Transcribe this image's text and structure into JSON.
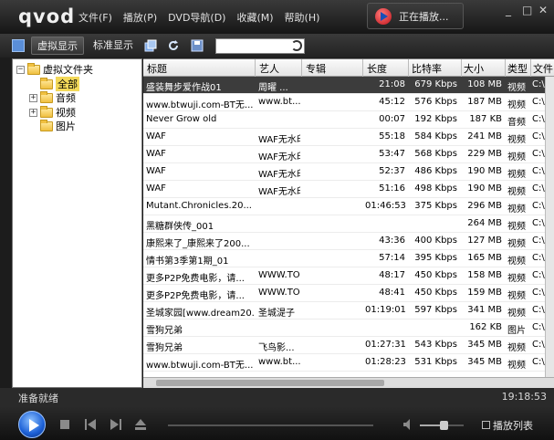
{
  "app": {
    "logo": "qvod",
    "menu": [
      "文件(F)",
      "播放(P)",
      "DVD导航(D)",
      "收藏(M)",
      "帮助(H)"
    ],
    "now_playing": "正在播放...",
    "window_controls": {
      "minimize": "_",
      "maximize": "□",
      "close": "✕"
    }
  },
  "toolbar": {
    "virtual_view": "虚拟显示",
    "standard_view": "标准显示",
    "search": {
      "value": "",
      "placeholder": ""
    }
  },
  "tree": {
    "root": "虚拟文件夹",
    "root_toggle": "−",
    "children": [
      {
        "label": "全部",
        "toggle": "",
        "selected": true
      },
      {
        "label": "音频",
        "toggle": "+",
        "selected": false
      },
      {
        "label": "视频",
        "toggle": "+",
        "selected": false
      },
      {
        "label": "图片",
        "toggle": "",
        "selected": false
      }
    ]
  },
  "list": {
    "columns": [
      "标题",
      "艺人",
      "专辑",
      "长度",
      "比特率",
      "大小",
      "类型",
      "文件"
    ],
    "rows": [
      {
        "title": "盛装舞步爱作战01",
        "artist": "周曜  ...",
        "album": "",
        "length": "21:08",
        "bitrate": "679 Kbps",
        "size": "108 MB",
        "type": "视频",
        "file": "C:\\",
        "selected": true
      },
      {
        "title": "www.btwuji.com-BT无...",
        "artist": "www.bt...",
        "album": "",
        "length": "45:12",
        "bitrate": "576 Kbps",
        "size": "187 MB",
        "type": "视频",
        "file": "C:\\",
        "selected": false
      },
      {
        "title": "Never Grow old",
        "artist": "",
        "album": "",
        "length": "00:07",
        "bitrate": "192 Kbps",
        "size": "187 KB",
        "type": "音频",
        "file": "C:\\",
        "selected": false
      },
      {
        "title": "WAF",
        "artist": "WAF无水印",
        "album": "",
        "length": "55:18",
        "bitrate": "584 Kbps",
        "size": "241 MB",
        "type": "视频",
        "file": "C:\\",
        "selected": false
      },
      {
        "title": "WAF",
        "artist": "WAF无水印",
        "album": "",
        "length": "53:47",
        "bitrate": "568 Kbps",
        "size": "229 MB",
        "type": "视频",
        "file": "C:\\",
        "selected": false
      },
      {
        "title": "WAF",
        "artist": "WAF无水印",
        "album": "",
        "length": "52:37",
        "bitrate": "486 Kbps",
        "size": "190 MB",
        "type": "视频",
        "file": "C:\\",
        "selected": false
      },
      {
        "title": "WAF",
        "artist": "WAF无水印",
        "album": "",
        "length": "51:16",
        "bitrate": "498 Kbps",
        "size": "190 MB",
        "type": "视频",
        "file": "C:\\",
        "selected": false
      },
      {
        "title": "Mutant.Chronicles.20...",
        "artist": "",
        "album": "",
        "length": "01:46:53",
        "bitrate": "375 Kbps",
        "size": "296 MB",
        "type": "视频",
        "file": "C:\\",
        "selected": false
      },
      {
        "title": "黑糖群侠传_001",
        "artist": "",
        "album": "",
        "length": "",
        "bitrate": "",
        "size": "264 MB",
        "type": "视频",
        "file": "C:\\",
        "selected": false
      },
      {
        "title": "康熙来了_康熙来了200...",
        "artist": "",
        "album": "",
        "length": "43:36",
        "bitrate": "400 Kbps",
        "size": "127 MB",
        "type": "视频",
        "file": "C:\\",
        "selected": false
      },
      {
        "title": "情书第3季第1期_01",
        "artist": "",
        "album": "",
        "length": "57:14",
        "bitrate": "395 Kbps",
        "size": "165 MB",
        "type": "视频",
        "file": "C:\\",
        "selected": false
      },
      {
        "title": "更多P2P免费电影，请...",
        "artist": "WWW.TO...",
        "album": "",
        "length": "48:17",
        "bitrate": "450 Kbps",
        "size": "158 MB",
        "type": "视频",
        "file": "C:\\",
        "selected": false
      },
      {
        "title": "更多P2P免费电影，请...",
        "artist": "WWW.TO...",
        "album": "",
        "length": "48:41",
        "bitrate": "450 Kbps",
        "size": "159 MB",
        "type": "视频",
        "file": "C:\\",
        "selected": false
      },
      {
        "title": "圣城家园[www.dream20...",
        "artist": "圣城湜子",
        "album": "",
        "length": "01:19:01",
        "bitrate": "597 Kbps",
        "size": "341 MB",
        "type": "视频",
        "file": "C:\\",
        "selected": false
      },
      {
        "title": "雪狗兄弟",
        "artist": "",
        "album": "",
        "length": "",
        "bitrate": "",
        "size": "162 KB",
        "type": "图片",
        "file": "C:\\",
        "selected": false
      },
      {
        "title": "雪狗兄弟",
        "artist": "飞鸟影...",
        "album": "",
        "length": "01:27:31",
        "bitrate": "543 Kbps",
        "size": "345 MB",
        "type": "视频",
        "file": "C:\\",
        "selected": false
      },
      {
        "title": "www.btwuji.com-BT无...",
        "artist": "www.bt...",
        "album": "",
        "length": "01:28:23",
        "bitrate": "531 Kbps",
        "size": "345 MB",
        "type": "视频",
        "file": "C:\\",
        "selected": false
      }
    ]
  },
  "status": {
    "left": "准备就绪",
    "time": "19:18:53"
  },
  "player": {
    "playlist_label": "播放列表",
    "volume_level": 0.55
  },
  "colors": {
    "selected_row": "#3c3c3c",
    "accent_blue": "#1b5fd6",
    "tree_highlight": "#f3d95a"
  }
}
